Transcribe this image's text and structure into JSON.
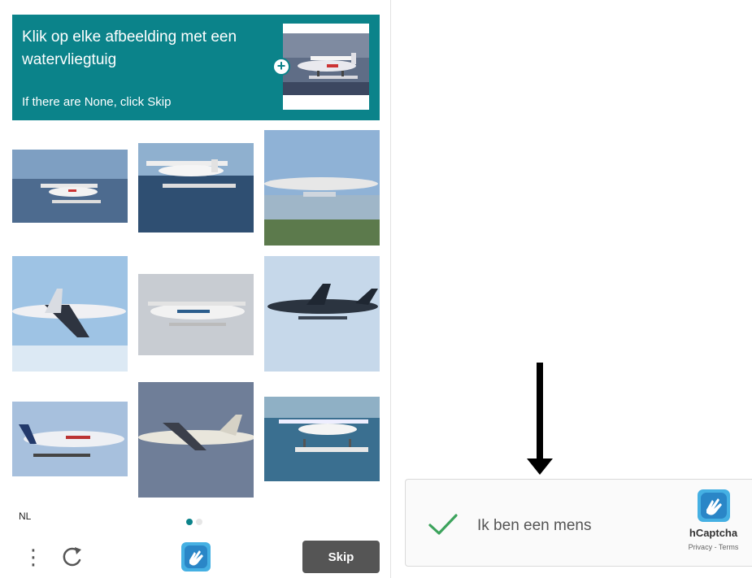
{
  "challenge": {
    "prompt_text": "Klik op elke afbeelding met een watervliegtuig",
    "prompt_subtext": "If there are None, click Skip",
    "tiles_count": 9
  },
  "footer": {
    "language": "NL",
    "skip_label": "Skip",
    "menu_glyph": "⋮"
  },
  "widget": {
    "label": "Ik ben een mens",
    "brand": "hCaptcha",
    "privacy_link": "Privacy",
    "separator": " - ",
    "terms_link": "Terms"
  },
  "colors": {
    "accent": "#0b838a",
    "check": "#3ca35c",
    "skip_button": "#555555"
  },
  "icons": [
    "plus-icon",
    "menu-icon",
    "refresh-icon",
    "hcaptcha-logo-icon",
    "checkmark-icon",
    "down-arrow-icon"
  ]
}
